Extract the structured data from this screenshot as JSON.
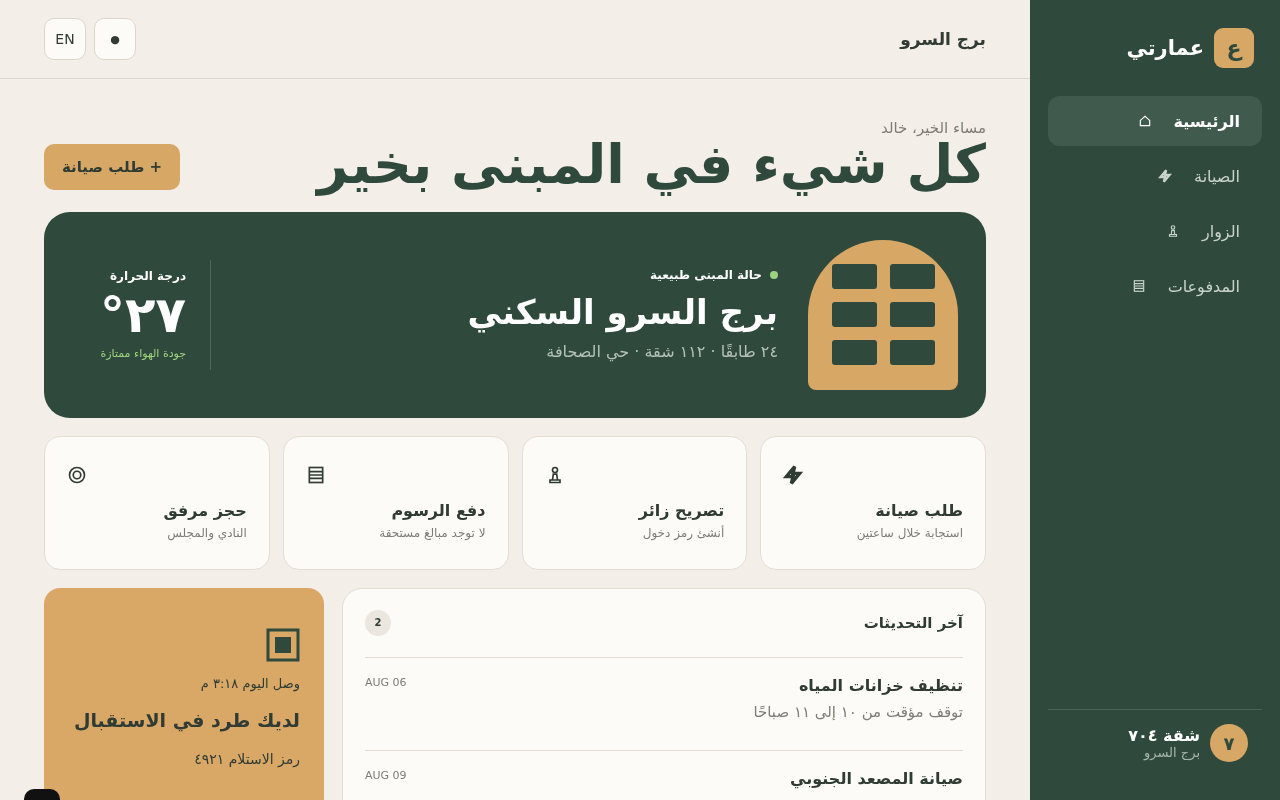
{
  "sidebar": {
    "logo_mark": "ع",
    "brand": "عمارتي",
    "nav": [
      {
        "kind": "home",
        "label": "الرئيسية",
        "selected": true
      },
      {
        "kind": "maintenance",
        "label": "الصيانة",
        "selected": false
      },
      {
        "kind": "visitors",
        "label": "الزوار",
        "selected": false
      },
      {
        "kind": "payments",
        "label": "المدفوعات",
        "selected": false
      }
    ],
    "user": {
      "avatar": "٧",
      "name": "شقة ٧٠٤",
      "building": "برج السرو"
    }
  },
  "header": {
    "building": "برج السرو",
    "buttons": [
      {
        "kind": "theme",
        "label": "●"
      },
      {
        "kind": "language",
        "label": "EN"
      }
    ]
  },
  "hero": {
    "greeting": "مساء الخير، خالد",
    "title": "كل شيء في المبنى بخير",
    "action": "+ طلب صيانة"
  },
  "building_card": {
    "status": "حالة المبنى طبيعية",
    "name": "برج السرو السكني",
    "details": "٢٤ طابقًا · ١١٢ شقة · حي الصحافة",
    "temperature": {
      "label": "درجة الحرارة",
      "value": "٢٧°",
      "note": "جودة الهواء ممتازة"
    }
  },
  "quick_actions": [
    {
      "kind": "maintenance",
      "title": "طلب صيانة",
      "subtitle": "استجابة خلال ساعتين"
    },
    {
      "kind": "visitors",
      "title": "تصريح زائر",
      "subtitle": "أنشئ رمز دخول"
    },
    {
      "kind": "payments",
      "title": "دفع الرسوم",
      "subtitle": "لا توجد مبالغ مستحقة"
    },
    {
      "kind": "booking",
      "title": "حجز مرفق",
      "subtitle": "النادي والمجلس"
    }
  ],
  "updates": {
    "title": "آخر التحديثات",
    "count": "2",
    "items": [
      {
        "date": "AUG 06",
        "title": "تنظيف خزانات المياه",
        "text": "توقف مؤقت من ١٠ إلى ١١ صباحًا"
      },
      {
        "date": "AUG 09",
        "title": "صيانة المصعد الجنوبي"
      }
    ]
  },
  "package": {
    "arrived": "وصل اليوم ٣:١٨ م",
    "title": "لديك طرد في الاستقبال",
    "code": "رمز الاستلام ٤٩٢١"
  }
}
